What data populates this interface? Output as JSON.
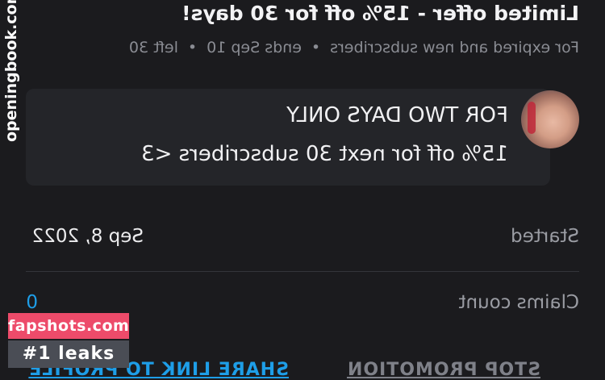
{
  "offer": {
    "title": "Limited offer - 15% off for 30 days!",
    "meta_audience": "For expired and new subscribers",
    "meta_separator": "•",
    "meta_ends": "ends Sep 10",
    "meta_left": "left 30"
  },
  "message": {
    "line1": "FOR TWO DAYS ONLY",
    "line2": "15% off for next 30 subscribers <3"
  },
  "details": {
    "started_label": "Started",
    "started_value": "Sep 8, 2022",
    "claims_label": "Claims count",
    "claims_value": "0"
  },
  "actions": {
    "stop_promotion": "STOP PROMOTION",
    "share_link": "SHARE LINK TO PROFILE",
    "accent_color": "#1e9ee8"
  },
  "watermarks": {
    "side_text": "openingbook.com",
    "badge_top": "fapshots.com",
    "badge_bottom": "#1 leaks",
    "badge_top_color": "#ed4b6a",
    "badge_bottom_color": "#4a4d55"
  }
}
